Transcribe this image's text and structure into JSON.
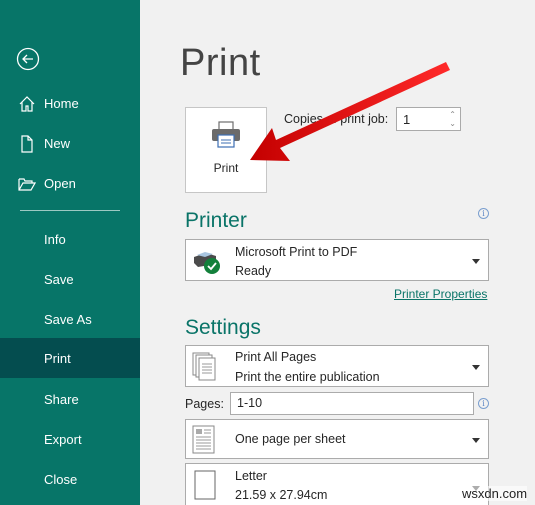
{
  "sidebar": {
    "back_icon": "back-arrow-circle-icon",
    "items": [
      {
        "label": "Home",
        "icon": "home-icon"
      },
      {
        "label": "New",
        "icon": "new-document-icon"
      },
      {
        "label": "Open",
        "icon": "folder-open-icon"
      },
      {
        "label": "Info"
      },
      {
        "label": "Save"
      },
      {
        "label": "Save As"
      },
      {
        "label": "Print",
        "selected": true
      },
      {
        "label": "Share"
      },
      {
        "label": "Export"
      },
      {
        "label": "Close"
      }
    ]
  },
  "main": {
    "title": "Print",
    "print_button_label": "Print",
    "copies_label": "Copies of print job:",
    "copies_value": "1",
    "printer": {
      "section_title": "Printer",
      "name": "Microsoft Print to PDF",
      "status": "Ready",
      "properties_link": "Printer Properties"
    },
    "settings": {
      "section_title": "Settings",
      "range_title": "Print All Pages",
      "range_desc": "Print the entire publication",
      "pages_label": "Pages:",
      "pages_value": "1-10",
      "layout": "One page per sheet",
      "paper_name": "Letter",
      "paper_size": "21.59 x 27.94cm"
    }
  },
  "colors": {
    "sidebar_bg": "#077568",
    "sidebar_selected": "#044d4f",
    "accent": "#0a7468",
    "annotation_arrow": "#e41b1b"
  },
  "watermark": "wsxdn.com"
}
